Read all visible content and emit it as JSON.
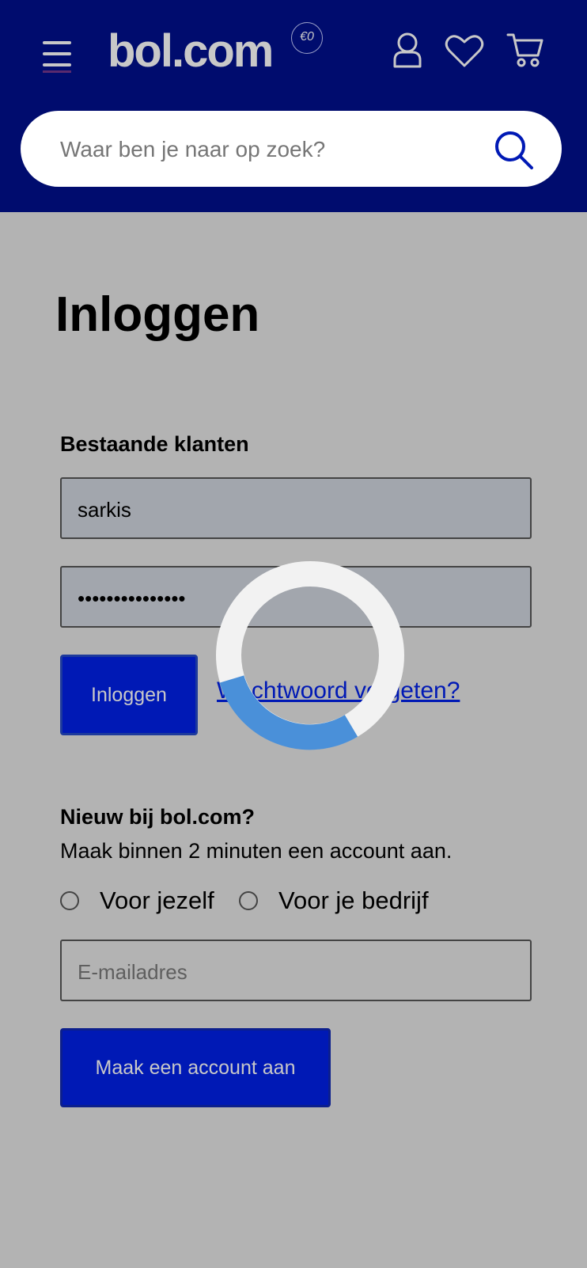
{
  "header": {
    "logo_text": "bol.com",
    "logo_badge": "€0",
    "icons": [
      "menu-icon",
      "account-icon",
      "heart-icon",
      "cart-icon"
    ],
    "search": {
      "placeholder": "Waar ben je naar op zoek?",
      "value": ""
    }
  },
  "page": {
    "title": "Inloggen",
    "existing": {
      "label": "Bestaande klanten",
      "username_value": "sarkis",
      "password_value": "•••••••••••••••",
      "login_button": "Inloggen",
      "forgot_link": "Wachtwoord vergeten?"
    },
    "new": {
      "label": "Nieuw bij bol.com?",
      "subtitle": "Maak binnen 2 minuten een account aan.",
      "radio_personal": "Voor jezelf",
      "radio_business": "Voor je bedrijf",
      "email_placeholder": "E-mailadres",
      "create_button": "Maak een account aan"
    }
  },
  "colors": {
    "header_bg": "#000c6e",
    "page_bg": "#b3b3b3",
    "primary": "#0019b5",
    "spinner_track": "#f2f2f2",
    "spinner_arc": "#4a90d9"
  },
  "loading": true
}
